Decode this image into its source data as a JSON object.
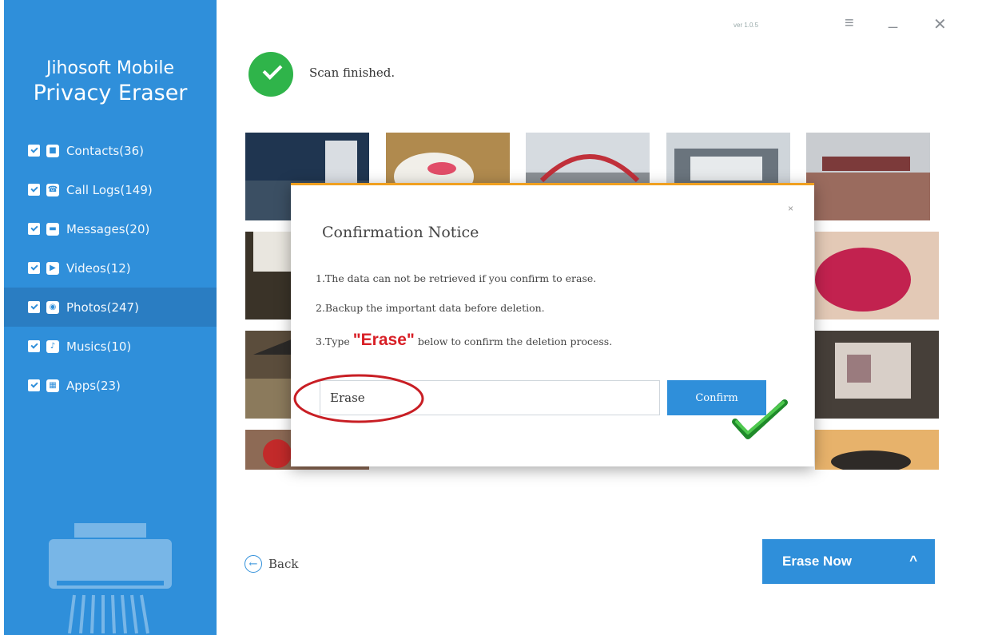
{
  "app": {
    "title_line1": "Jihosoft Mobile",
    "title_line2": "Privacy Eraser",
    "version": "ver 1.0.5"
  },
  "window_controls": {
    "menu": "≡",
    "minimize": "_",
    "close": "✕"
  },
  "categories": [
    {
      "label": "Contacts(36)",
      "icon": "contacts-icon",
      "glyph": "■",
      "checked": true,
      "active": false
    },
    {
      "label": "Call Logs(149)",
      "icon": "call-logs-icon",
      "glyph": "☎",
      "checked": true,
      "active": false
    },
    {
      "label": "Messages(20)",
      "icon": "messages-icon",
      "glyph": "▬",
      "checked": true,
      "active": false
    },
    {
      "label": "Videos(12)",
      "icon": "videos-icon",
      "glyph": "▶",
      "checked": true,
      "active": false
    },
    {
      "label": "Photos(247)",
      "icon": "photos-icon",
      "glyph": "◉",
      "checked": true,
      "active": true
    },
    {
      "label": "Musics(10)",
      "icon": "musics-icon",
      "glyph": "♪",
      "checked": true,
      "active": false
    },
    {
      "label": "Apps(23)",
      "icon": "apps-icon",
      "glyph": "▦",
      "checked": true,
      "active": false
    }
  ],
  "status": {
    "text": "Scan finished."
  },
  "modal": {
    "title": "Confirmation Notice",
    "close": "×",
    "line1": "1.The data can not be retrieved if you confirm to erase.",
    "line2": "2.Backup the important data before deletion.",
    "line3_prefix": "3.Type ",
    "line3_highlight": "\"Erase\"",
    "line3_suffix": " below to confirm the deletion process.",
    "input_value": "Erase",
    "confirm_label": "Confirm"
  },
  "footer": {
    "back_label": "Back",
    "back_glyph": "←",
    "erase_now_label": "Erase Now",
    "erase_now_glyph": "^"
  },
  "colors": {
    "sidebar": "#2f8fda",
    "sidebar_active": "#2a7dc2",
    "accent": "#2f8fda",
    "success": "#2fb44a",
    "highlight": "#d81f26",
    "modal_top": "#f0a020"
  }
}
